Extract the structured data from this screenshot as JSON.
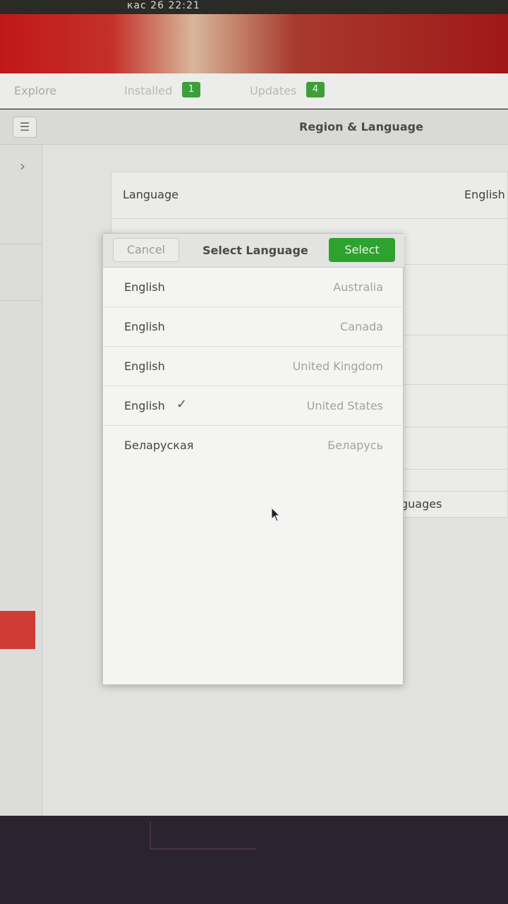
{
  "topbar": {
    "clock": "кас 26  22:21"
  },
  "tabs": {
    "explore": "Explore",
    "installed": "Installed",
    "installed_count": "1",
    "updates": "Updates",
    "updates_count": "4"
  },
  "settings": {
    "title": "Region & Language",
    "language_label": "Language",
    "language_value": "English (",
    "manage_label": "guages"
  },
  "dialog": {
    "title": "Select Language",
    "cancel_label": "Cancel",
    "select_label": "Select",
    "languages": [
      {
        "name": "English",
        "region": "Australia",
        "selected": false
      },
      {
        "name": "English",
        "region": "Canada",
        "selected": false
      },
      {
        "name": "English",
        "region": "United Kingdom",
        "selected": false
      },
      {
        "name": "English",
        "region": "United States",
        "selected": true
      },
      {
        "name": "Беларуская",
        "region": "Беларусь",
        "selected": false
      }
    ]
  },
  "colors": {
    "accent_green": "#2da22f",
    "accent_red": "#cf3b36",
    "badge_green": "#3e9f3a"
  }
}
